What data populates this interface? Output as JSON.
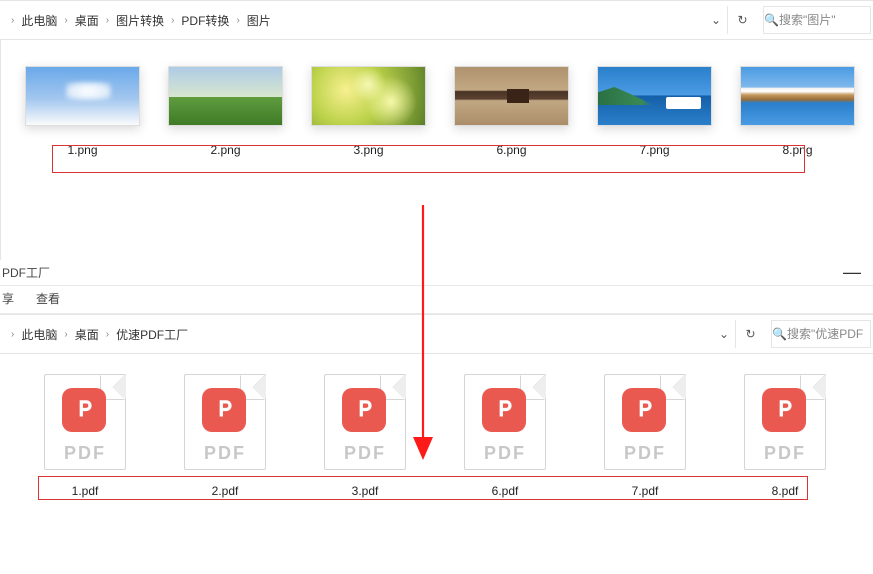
{
  "window1": {
    "breadcrumb": [
      "此电脑",
      "桌面",
      "图片转换",
      "PDF转换",
      "图片"
    ],
    "search_placeholder": "搜索\"图片\"",
    "files": [
      {
        "name": "1.png",
        "thumbClass": "sky1"
      },
      {
        "name": "2.png",
        "thumbClass": "field"
      },
      {
        "name": "3.png",
        "thumbClass": "yellow"
      },
      {
        "name": "6.png",
        "thumbClass": "brown"
      },
      {
        "name": "7.png",
        "thumbClass": "lake"
      },
      {
        "name": "8.png",
        "thumbClass": "mountain"
      }
    ]
  },
  "window2": {
    "title": "PDF工厂",
    "tabs": [
      "享",
      "查看"
    ],
    "breadcrumb": [
      "此电脑",
      "桌面",
      "优速PDF工厂"
    ],
    "search_placeholder": "搜索\"优速PDF",
    "pdf_label": "PDF",
    "files": [
      {
        "name": "1.pdf"
      },
      {
        "name": "2.pdf"
      },
      {
        "name": "3.pdf"
      },
      {
        "name": "6.pdf"
      },
      {
        "name": "7.pdf"
      },
      {
        "name": "8.pdf"
      }
    ]
  }
}
